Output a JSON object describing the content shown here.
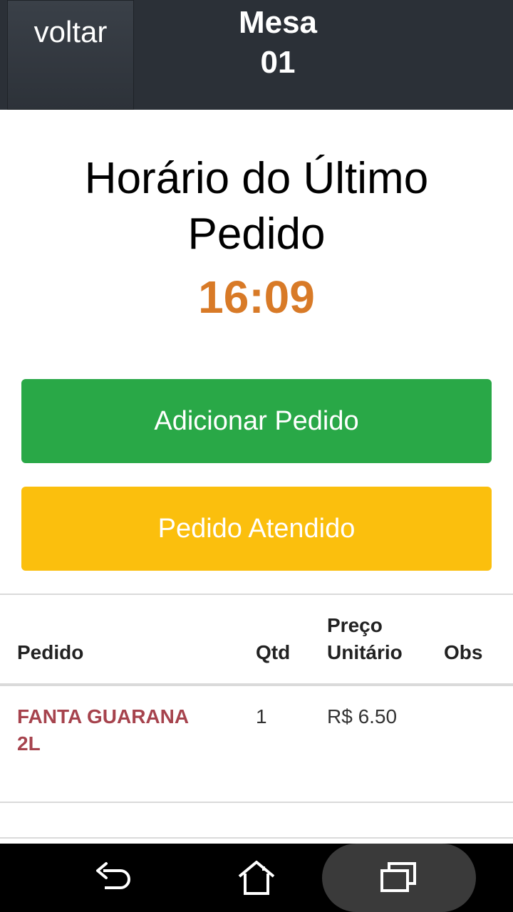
{
  "header": {
    "back_label": "voltar",
    "title_line1": "Mesa",
    "title_line2": "01"
  },
  "main": {
    "title_line1": "Horário do Último",
    "title_line2": "Pedido",
    "last_order_time": "16:09"
  },
  "actions": {
    "add_order_label": "Adicionar Pedido",
    "order_served_label": "Pedido Atendido"
  },
  "table": {
    "headers": {
      "item": "Pedido",
      "qty": "Qtd",
      "unit_price_line1": "Preço",
      "unit_price_line2": "Unitário",
      "notes": "Obs"
    },
    "rows": [
      {
        "item_line1": "FANTA GUARANA",
        "item_line2": "2L",
        "qty": "1",
        "unit_price": "R$ 6.50",
        "notes": ""
      }
    ]
  },
  "navbar": {
    "icons": [
      "back-icon",
      "home-icon",
      "recent-apps-icon"
    ]
  },
  "colors": {
    "header_bg": "#2b3037",
    "time": "#d87a27",
    "add_button": "#29a847",
    "served_button": "#fbbf0d",
    "item_name": "#a6434d"
  }
}
